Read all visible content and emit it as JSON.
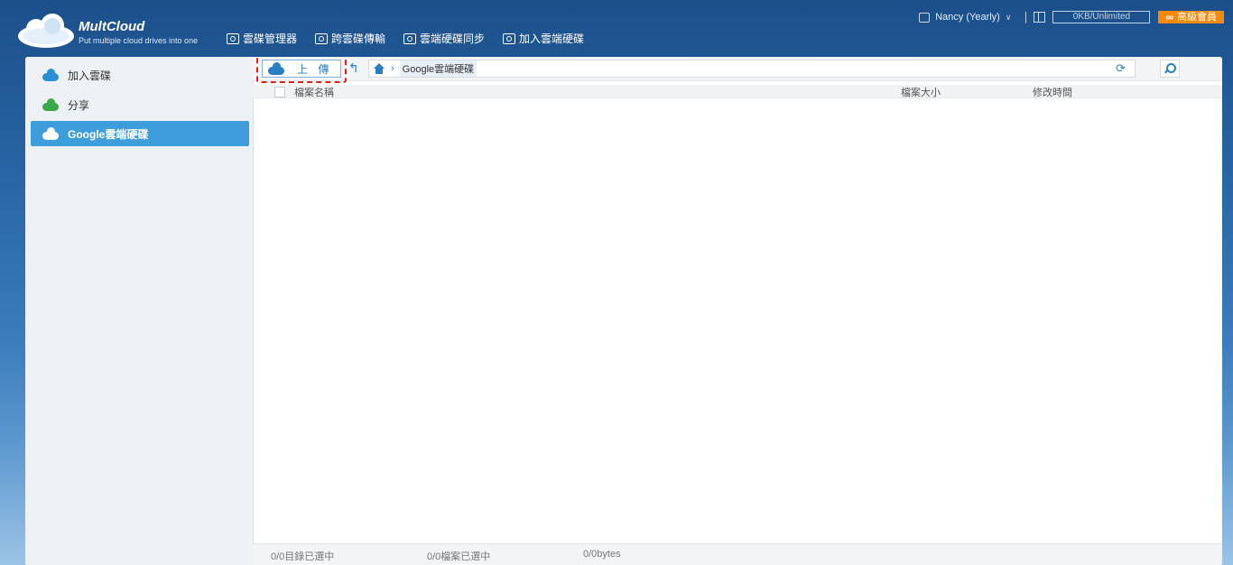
{
  "header": {
    "logo_title": "MultCloud",
    "logo_tagline": "Put multiple cloud drives into one",
    "nav": [
      {
        "label": "雲碟管理器",
        "icon": "drive-manager-icon"
      },
      {
        "label": "跨雲碟傳輸",
        "icon": "transfer-icon"
      },
      {
        "label": "雲端硬碟同步",
        "icon": "sync-icon"
      },
      {
        "label": "加入雲端硬碟",
        "icon": "add-drive-icon"
      }
    ],
    "user": "Nancy (Yearly)",
    "storage": "0KB/Unlimited",
    "premium": "高級會員"
  },
  "sidebar": {
    "items": [
      {
        "label": "加入雲碟",
        "icon": "add-cloud-icon",
        "color": "#2a8fd6"
      },
      {
        "label": "分享",
        "icon": "share-cloud-icon",
        "color": "#3aa84a"
      },
      {
        "label": "Google雲端硬碟",
        "icon": "google-drive-icon",
        "color": "#ffffff"
      }
    ]
  },
  "toolbar": {
    "upload_label": "上 傳",
    "breadcrumb": "Google雲端硬碟"
  },
  "table": {
    "headers": {
      "name": "檔案名稱",
      "size": "檔案大小",
      "time": "修改時間"
    }
  },
  "status": {
    "folders": "0/0目錄已選中",
    "files": "0/0檔案已選中",
    "bytes": "0/0bytes"
  },
  "colors": {
    "accent": "#3e9ddb",
    "premium": "#f58a0b",
    "highlight": "#e0201f"
  }
}
